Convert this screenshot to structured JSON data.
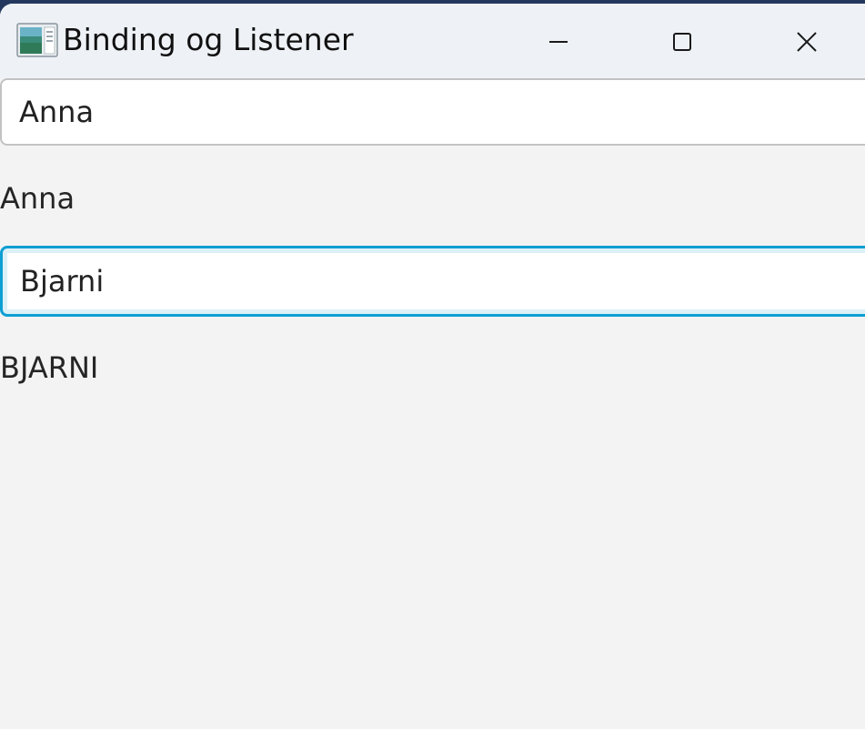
{
  "window": {
    "title": "Binding og Listener",
    "icon": "java-app-icon",
    "controls": {
      "minimize_icon": "minimize-icon",
      "maximize_icon": "maximize-icon",
      "close_icon": "close-icon"
    }
  },
  "form": {
    "first_field_value": "Anna",
    "first_label": "Anna",
    "second_field_value": "Bjarni",
    "second_label": "BJARNI"
  },
  "colors": {
    "window_background": "#f3f3f3",
    "titlebar_background": "#eef2f6",
    "focus_border": "#0d9fd3",
    "desktop": "#24385e"
  }
}
